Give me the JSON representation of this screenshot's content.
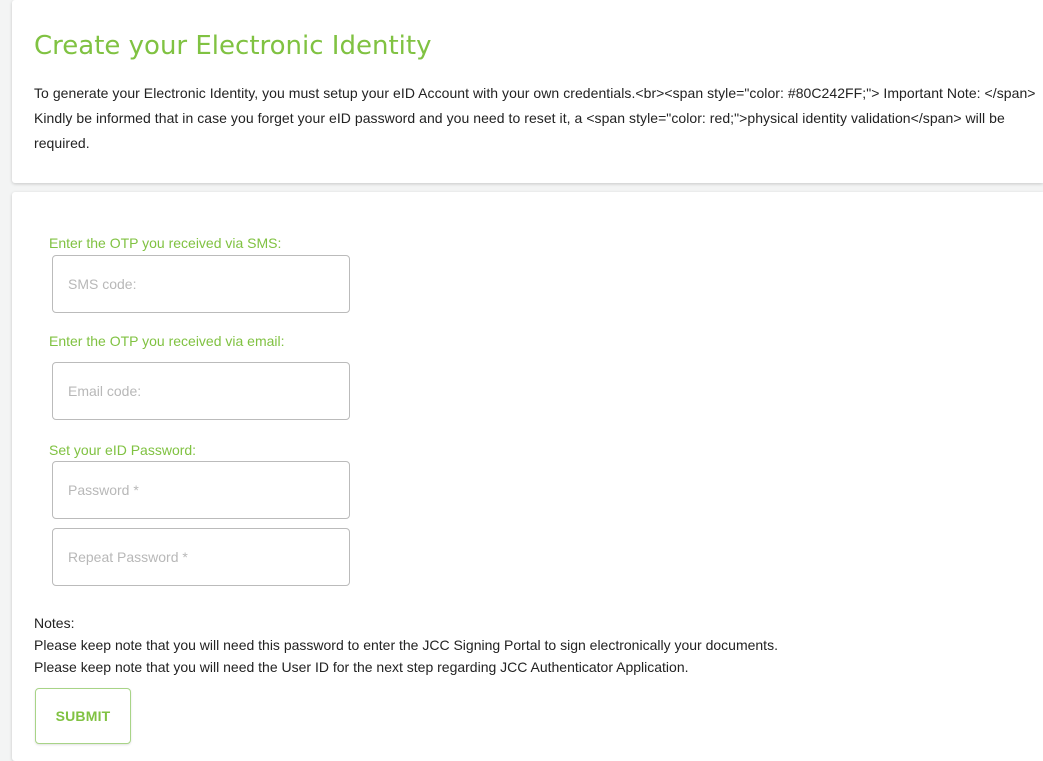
{
  "header": {
    "title": "Create your Electronic Identity",
    "intro_text": "To generate your Electronic Identity, you must setup your eID Account with your own credentials.<br><span style=\"color: #80C242FF;\"> Important Note: </span> Kindly be informed that in case you forget your eID password and you need to reset it, a <span style=\"color: red;\">physical identity validation</span> will be required."
  },
  "form": {
    "sms": {
      "label": "Enter the OTP you received via SMS:",
      "placeholder": "SMS code:",
      "value": ""
    },
    "email": {
      "label": "Enter the OTP you received via email:",
      "placeholder": "Email code:",
      "value": ""
    },
    "password": {
      "label": "Set your eID Password:",
      "placeholder": "Password *",
      "value": ""
    },
    "repeat_password": {
      "placeholder": "Repeat Password *",
      "value": ""
    },
    "notes": {
      "heading": "Notes:",
      "line1": "Please keep note that you will need this password to enter the JCC Signing Portal to sign electronically your documents.",
      "line2": "Please keep note that you will need the User ID for the next step regarding JCC Authenticator Application."
    },
    "submit_label": "SUBMIT"
  },
  "colors": {
    "accent": "#80C242",
    "page_background": "#F3F4F4",
    "card_background": "#FFFFFF",
    "input_border": "#BBBBBB",
    "placeholder": "#B8B8B8"
  }
}
